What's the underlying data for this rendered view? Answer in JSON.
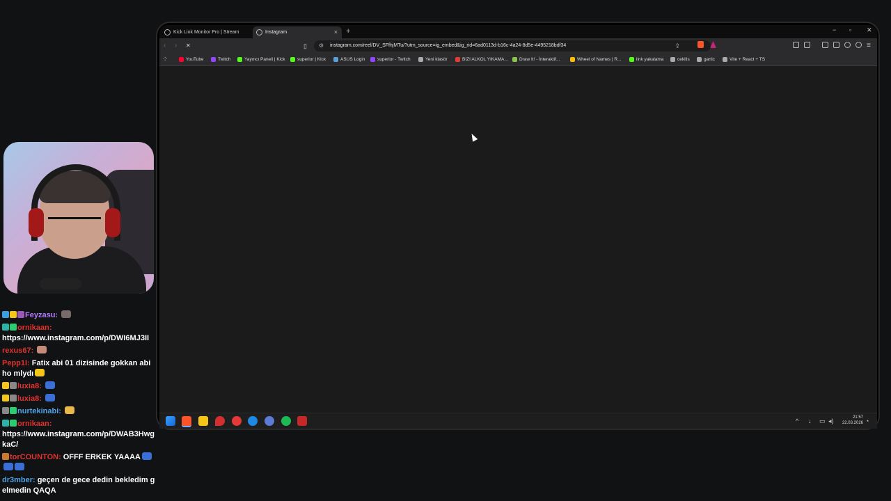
{
  "browser": {
    "tabs": [
      {
        "label": "Kick Link Monitor Pro | Stream Deck",
        "active": false
      },
      {
        "label": "Instagram",
        "active": true
      }
    ],
    "new_tab": "+",
    "window_controls": {
      "minimize": "−",
      "maximize": "▫",
      "close": "✕"
    },
    "url": "instagram.com/reel/DV_SFfhjMTu/?utm_source=ig_embed&ig_rid=6ad0113d-b16c-4a24-8d5e-4495218bdf34",
    "reload_icon": "✕",
    "bookmarks": [
      {
        "label": "YouTube",
        "color": "#ff0033"
      },
      {
        "label": "Twitch",
        "color": "#9146ff"
      },
      {
        "label": "Yayıncı Paneli | Kick",
        "color": "#53fc18"
      },
      {
        "label": "superior | Kick",
        "color": "#53fc18"
      },
      {
        "label": "ASUS Login",
        "color": "#5aa0d8"
      },
      {
        "label": "superior - Twitch",
        "color": "#9146ff"
      },
      {
        "label": "Yeni klasör",
        "color": "#aaaaaa"
      },
      {
        "label": "BIZI ALKOL YIKAMA...",
        "color": "#e53935"
      },
      {
        "label": "Draw It! - İnteraktif...",
        "color": "#8bc34a"
      },
      {
        "label": "Wheel of Names | R...",
        "color": "#fbbc04"
      },
      {
        "label": "link yakalama",
        "color": "#53fc18"
      },
      {
        "label": "cekilis",
        "color": "#aaaaaa"
      },
      {
        "label": "gartic",
        "color": "#aaaaaa"
      },
      {
        "label": "Vite + React + TS",
        "color": "#aaaaaa"
      }
    ]
  },
  "taskbar": {
    "time": "21:57",
    "date": "22.03.2026"
  },
  "chat": [
    {
      "user": "Feyzasu:",
      "user_color": "#b77cff",
      "text": "",
      "badges": [
        "#3aa0e0",
        "#f5c518",
        "#9b59b6"
      ],
      "emotes": [
        "#7a6a6a"
      ]
    },
    {
      "user": "ornikaan:",
      "user_color": "#e0332f",
      "text": "https://www.instagram.com/p/DWI6MJ3II",
      "badges": [
        "#2bb3a8",
        "#2ecc71"
      ],
      "emotes": []
    },
    {
      "user": "rexus67:",
      "user_color": "#e0332f",
      "text": "",
      "badges": [],
      "emotes": [
        "#c48a7a"
      ]
    },
    {
      "user": "Pepp1I:",
      "user_color": "#e0332f",
      "text": "Fatix abi 01 dizisinde gokkan abi ho mlydı",
      "badges": [],
      "emotes": [
        "#f5c518"
      ]
    },
    {
      "user": "luxia8:",
      "user_color": "#e0332f",
      "text": "",
      "badges": [
        "#f5c518",
        "#888888"
      ],
      "emotes": [
        "#3a6fd8"
      ]
    },
    {
      "user": "luxia8:",
      "user_color": "#e0332f",
      "text": "",
      "badges": [
        "#f5c518",
        "#888888"
      ],
      "emotes": [
        "#3a6fd8"
      ]
    },
    {
      "user": "nurtekinabi:",
      "user_color": "#4fa3e8",
      "text": "",
      "badges": [
        "#888888",
        "#2ecc71"
      ],
      "emotes": [
        "#e8b84a"
      ]
    },
    {
      "user": "ornikaan:",
      "user_color": "#e0332f",
      "text": "https://www.instagram.com/p/DWAB3HwgkaC/",
      "badges": [
        "#2bb3a8",
        "#2ecc71"
      ],
      "emotes": []
    },
    {
      "user": "torCOUNTON:",
      "user_color": "#e0332f",
      "text": "OFFF ERKEK YAAAA",
      "badges": [
        "#c97a30"
      ],
      "emotes": [
        "#3a6fd8",
        "#3a6fd8",
        "#3a6fd8"
      ]
    },
    {
      "user": "dr3mber:",
      "user_color": "#4fa3e8",
      "text": "geçen de gece dedin bekledim gelmedin QAQA",
      "badges": [],
      "emotes": []
    }
  ]
}
